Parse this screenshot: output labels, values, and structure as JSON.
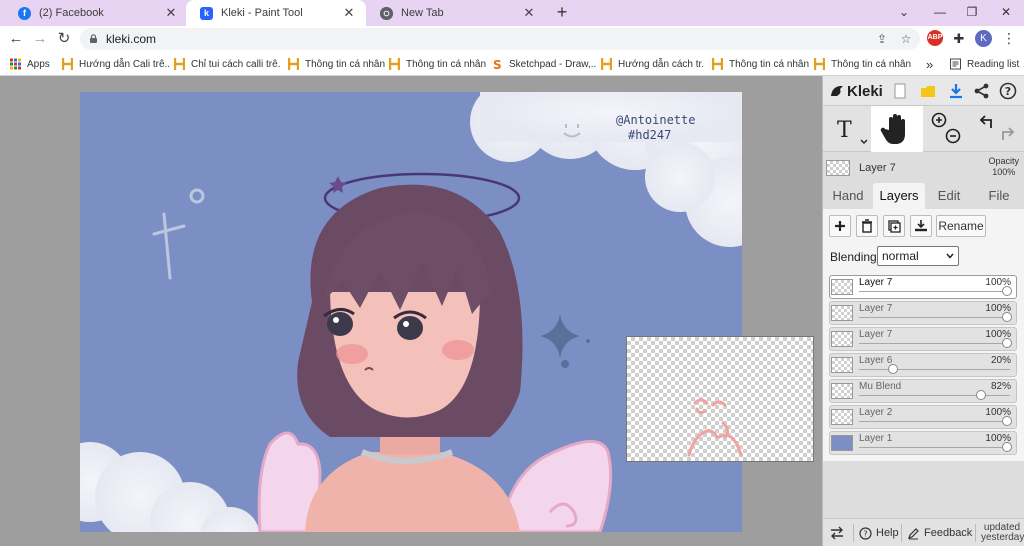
{
  "tabs": [
    {
      "title": "(2) Facebook",
      "icon": "facebook-icon",
      "color": "#1877f2"
    },
    {
      "title": "Kleki - Paint Tool",
      "icon": "kleki-icon",
      "color": "#2962ff"
    },
    {
      "title": "New Tab",
      "icon": "chrome-icon",
      "color": "#5f6368"
    }
  ],
  "address": {
    "url": "kleki.com"
  },
  "bookmarks": {
    "apps_label": "Apps",
    "items": [
      {
        "label": "Hướng dẫn Cali trê...",
        "icon": "bookmark-h-icon"
      },
      {
        "label": "Chỉ tui cách calli trê...",
        "icon": "bookmark-h-icon"
      },
      {
        "label": "Thông tin cá nhân",
        "icon": "bookmark-h-icon"
      },
      {
        "label": "Thông tin cá nhân",
        "icon": "bookmark-h-icon"
      },
      {
        "label": "Sketchpad - Draw,...",
        "icon": "sketchpad-icon"
      },
      {
        "label": "Hướng dẫn cách tr...",
        "icon": "bookmark-h-icon"
      },
      {
        "label": "Thông tin cá nhân",
        "icon": "bookmark-h-icon"
      },
      {
        "label": "Thông tin cá nhân",
        "icon": "bookmark-h-icon"
      }
    ],
    "overflow_label": "»",
    "reading_list_label": "Reading list"
  },
  "extensions": {
    "abp_label": "ABP",
    "profile_initial": "K"
  },
  "artwork": {
    "handle": "@Antoinette",
    "tag": "#hd247"
  },
  "kleki": {
    "brand": "Kleki",
    "current_layer": {
      "name": "Layer 7",
      "opacity_label": "Opacity",
      "opacity_value": "100%"
    },
    "tabs": [
      "Hand",
      "Layers",
      "Edit",
      "File"
    ],
    "selected_tab": "Layers",
    "rename_label": "Rename",
    "blending_label": "Blending",
    "blending_value": "normal",
    "layers": [
      {
        "name": "Layer 7",
        "opacity": "100%",
        "value": 1.0,
        "active": true
      },
      {
        "name": "Layer 7",
        "opacity": "100%",
        "value": 1.0,
        "active": false
      },
      {
        "name": "Layer 7",
        "opacity": "100%",
        "value": 1.0,
        "active": false
      },
      {
        "name": "Layer 6",
        "opacity": "20%",
        "value": 0.2,
        "active": false
      },
      {
        "name": "Mu Blend",
        "opacity": "82%",
        "value": 0.82,
        "active": false
      },
      {
        "name": "Layer 2",
        "opacity": "100%",
        "value": 1.0,
        "active": false
      },
      {
        "name": "Layer 1",
        "opacity": "100%",
        "value": 1.0,
        "active": false
      }
    ],
    "footer": {
      "help_label": "Help",
      "feedback_label": "Feedback",
      "updated_line1": "updated",
      "updated_line2": "yesterday"
    }
  },
  "colors": {
    "tabstrip": "#e6d4f2",
    "canvas_bg": "#7b8fc5",
    "hair": "#6b4a63",
    "skin": "#f2b9b2",
    "wing": "#f3d6ec"
  }
}
